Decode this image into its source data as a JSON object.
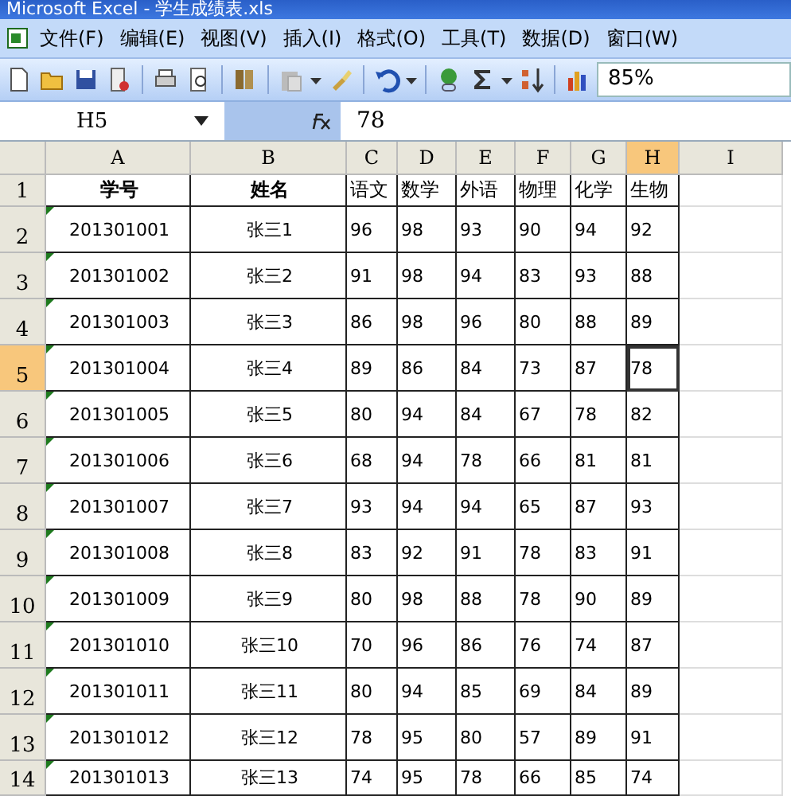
{
  "window": {
    "title": "Microsoft Excel - 学生成绩表.xls"
  },
  "menu": [
    "文件(F)",
    "编辑(E)",
    "视图(V)",
    "插入(I)",
    "格式(O)",
    "工具(T)",
    "数据(D)",
    "窗口(W)"
  ],
  "toolbar": {
    "zoom": "85%"
  },
  "formula_bar": {
    "name_box": "H5",
    "value": "78"
  },
  "columns": [
    {
      "label": "A",
      "selected": false
    },
    {
      "label": "B",
      "selected": false
    },
    {
      "label": "C",
      "selected": false
    },
    {
      "label": "D",
      "selected": false
    },
    {
      "label": "E",
      "selected": false
    },
    {
      "label": "F",
      "selected": false
    },
    {
      "label": "G",
      "selected": false
    },
    {
      "label": "H",
      "selected": true
    },
    {
      "label": "I",
      "selected": false
    }
  ],
  "rows": [
    {
      "label": "1",
      "selected": false,
      "flagged": false,
      "kind": "header",
      "cells": [
        "学号",
        "姓名",
        "语文",
        "数学",
        "外语",
        "物理",
        "化学",
        "生物"
      ]
    },
    {
      "label": "2",
      "selected": false,
      "flagged": true,
      "kind": "data",
      "cells": [
        "201301001",
        "张三1",
        "96",
        "98",
        "93",
        "90",
        "94",
        "92"
      ]
    },
    {
      "label": "3",
      "selected": false,
      "flagged": true,
      "kind": "data",
      "cells": [
        "201301002",
        "张三2",
        "91",
        "98",
        "94",
        "83",
        "93",
        "88"
      ]
    },
    {
      "label": "4",
      "selected": false,
      "flagged": true,
      "kind": "data",
      "cells": [
        "201301003",
        "张三3",
        "86",
        "98",
        "96",
        "80",
        "88",
        "89"
      ]
    },
    {
      "label": "5",
      "selected": true,
      "flagged": true,
      "kind": "data",
      "cells": [
        "201301004",
        "张三4",
        "89",
        "86",
        "84",
        "73",
        "87",
        "78"
      ]
    },
    {
      "label": "6",
      "selected": false,
      "flagged": true,
      "kind": "data",
      "cells": [
        "201301005",
        "张三5",
        "80",
        "94",
        "84",
        "67",
        "78",
        "82"
      ]
    },
    {
      "label": "7",
      "selected": false,
      "flagged": true,
      "kind": "data",
      "cells": [
        "201301006",
        "张三6",
        "68",
        "94",
        "78",
        "66",
        "81",
        "81"
      ]
    },
    {
      "label": "8",
      "selected": false,
      "flagged": true,
      "kind": "data",
      "cells": [
        "201301007",
        "张三7",
        "93",
        "94",
        "94",
        "65",
        "87",
        "93"
      ]
    },
    {
      "label": "9",
      "selected": false,
      "flagged": true,
      "kind": "data",
      "cells": [
        "201301008",
        "张三8",
        "83",
        "92",
        "91",
        "78",
        "83",
        "91"
      ]
    },
    {
      "label": "10",
      "selected": false,
      "flagged": true,
      "kind": "data",
      "cells": [
        "201301009",
        "张三9",
        "80",
        "98",
        "88",
        "78",
        "90",
        "89"
      ]
    },
    {
      "label": "11",
      "selected": false,
      "flagged": true,
      "kind": "data",
      "cells": [
        "201301010",
        "张三10",
        "70",
        "96",
        "86",
        "76",
        "74",
        "87"
      ]
    },
    {
      "label": "12",
      "selected": false,
      "flagged": true,
      "kind": "data",
      "cells": [
        "201301011",
        "张三11",
        "80",
        "94",
        "85",
        "69",
        "84",
        "89"
      ]
    },
    {
      "label": "13",
      "selected": false,
      "flagged": true,
      "kind": "data",
      "cells": [
        "201301012",
        "张三12",
        "78",
        "95",
        "80",
        "57",
        "89",
        "91"
      ]
    },
    {
      "label": "14",
      "selected": false,
      "flagged": true,
      "kind": "data",
      "cells": [
        "201301013",
        "张三13",
        "74",
        "95",
        "78",
        "66",
        "85",
        "74"
      ]
    }
  ]
}
